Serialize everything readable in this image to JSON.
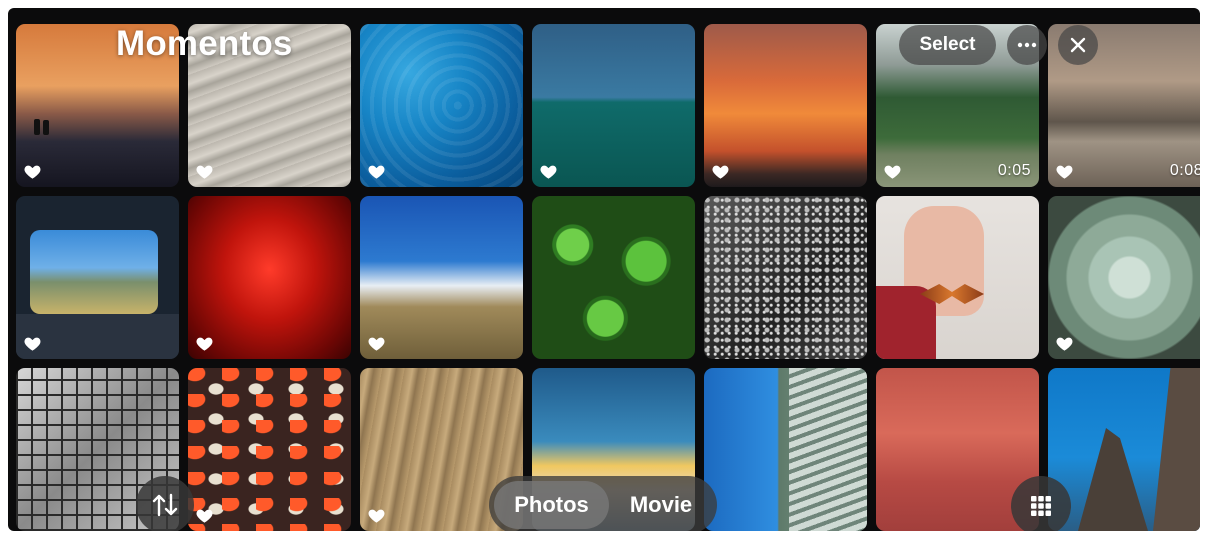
{
  "header": {
    "title": "Momentos"
  },
  "toolbar": {
    "select_label": "Select",
    "more_icon": "ellipsis-icon",
    "close_icon": "close-icon"
  },
  "bottom_bar": {
    "sort_icon": "sort-arrows-icon",
    "segments": [
      {
        "label": "Photos",
        "selected": true
      },
      {
        "label": "Movie",
        "selected": false
      }
    ],
    "grid_icon": "grid-view-icon"
  },
  "tiles": [
    {
      "subject": "sunset beach with two people",
      "favorite": true,
      "duration": ""
    },
    {
      "subject": "rippled sand",
      "favorite": true,
      "duration": ""
    },
    {
      "subject": "blue pool water",
      "favorite": true,
      "duration": ""
    },
    {
      "subject": "ocean horizon",
      "favorite": true,
      "duration": ""
    },
    {
      "subject": "orange sunset sky",
      "favorite": true,
      "duration": ""
    },
    {
      "subject": "green coastal cliffs",
      "favorite": true,
      "duration": "0:05"
    },
    {
      "subject": "river at dusk",
      "favorite": true,
      "duration": "0:08"
    },
    {
      "subject": "mountain through car window",
      "favorite": true,
      "duration": ""
    },
    {
      "subject": "red lit interior",
      "favorite": true,
      "duration": ""
    },
    {
      "subject": "clouds over hills",
      "favorite": true,
      "duration": ""
    },
    {
      "subject": "green round leaves",
      "favorite": false,
      "duration": ""
    },
    {
      "subject": "black and white texture",
      "favorite": false,
      "duration": ""
    },
    {
      "subject": "butterfly on hand",
      "favorite": false,
      "duration": ""
    },
    {
      "subject": "succulent plant",
      "favorite": true,
      "duration": ""
    },
    {
      "subject": "black and white wall pattern",
      "favorite": false,
      "duration": ""
    },
    {
      "subject": "koi fish pond",
      "favorite": true,
      "duration": ""
    },
    {
      "subject": "wavy sand dunes",
      "favorite": true,
      "duration": ""
    },
    {
      "subject": "cloud at sunset",
      "favorite": false,
      "duration": ""
    },
    {
      "subject": "building facade and sky",
      "favorite": false,
      "duration": ""
    },
    {
      "subject": "pink clouds",
      "favorite": false,
      "duration": ""
    },
    {
      "subject": "sea rocks",
      "favorite": false,
      "duration": ""
    }
  ],
  "colors": {
    "background": "#0b0b0c",
    "control_fill": "#464646",
    "text": "#ffffff"
  }
}
